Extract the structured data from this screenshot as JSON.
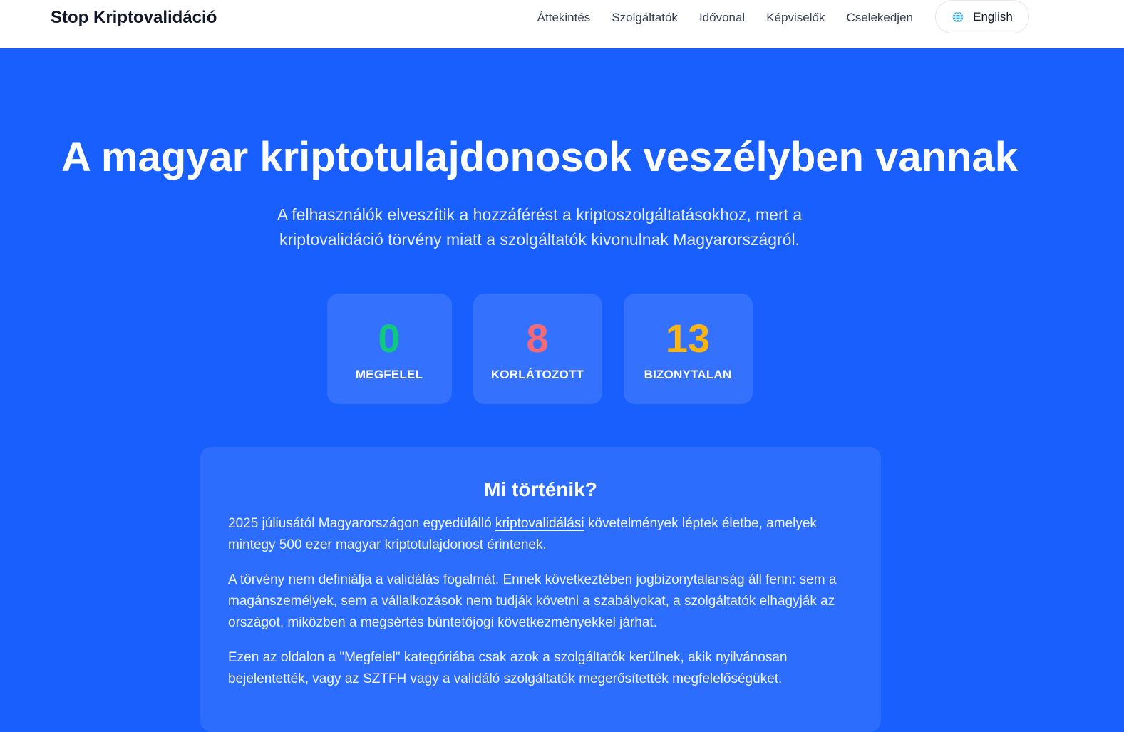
{
  "header": {
    "brand": "Stop Kriptovalidáció",
    "nav": [
      "Áttekintés",
      "Szolgáltatók",
      "Idővonal",
      "Képviselők",
      "Cselekedjen"
    ],
    "language": {
      "label": "English",
      "icon": "globe-icon"
    }
  },
  "hero": {
    "title": "A magyar kriptotulajdonosok veszélyben vannak",
    "subtitle_line1": "A felhasználók elveszítik a hozzáférést a kriptoszolgáltatásokhoz, mert a",
    "subtitle_line2": "kriptovalidáció törvény miatt a szolgáltatók kivonulnak Magyarországról."
  },
  "stats": [
    {
      "value": "0",
      "label": "MEGFELEL",
      "color": "#10c981"
    },
    {
      "value": "8",
      "label": "KORLÁTOZOTT",
      "color": "#f66a75"
    },
    {
      "value": "13",
      "label": "BIZONYTALAN",
      "color": "#f8b50f"
    }
  ],
  "info": {
    "title": "Mi történik?",
    "p1_before": "2025 júliusától Magyarországon egyedülálló ",
    "p1_link": "kriptovalidálási",
    "p1_after": " követelmények léptek életbe, amelyek mintegy 500 ezer magyar kriptotulajdonost érintenek.",
    "p2": "A törvény nem definiálja a validálás fogalmát. Ennek következtében jogbizonytalanság áll fenn: sem a magánszemélyek, sem a vállalkozások nem tudják követni a szabályokat, a szolgáltatók elhagyják az országot, miközben a megsértés büntetőjogi következményekkel járhat.",
    "p3": "Ezen az oldalon a \"Megfelel\" kategóriába csak azok a szolgáltatók kerülnek, akik nyilvánosan bejelentették, vagy az SZTFH vagy a validáló szolgáltatók megerősítették megfelelőségüket."
  },
  "colors": {
    "background": "#185ffe",
    "header_bg": "#ffffff"
  }
}
